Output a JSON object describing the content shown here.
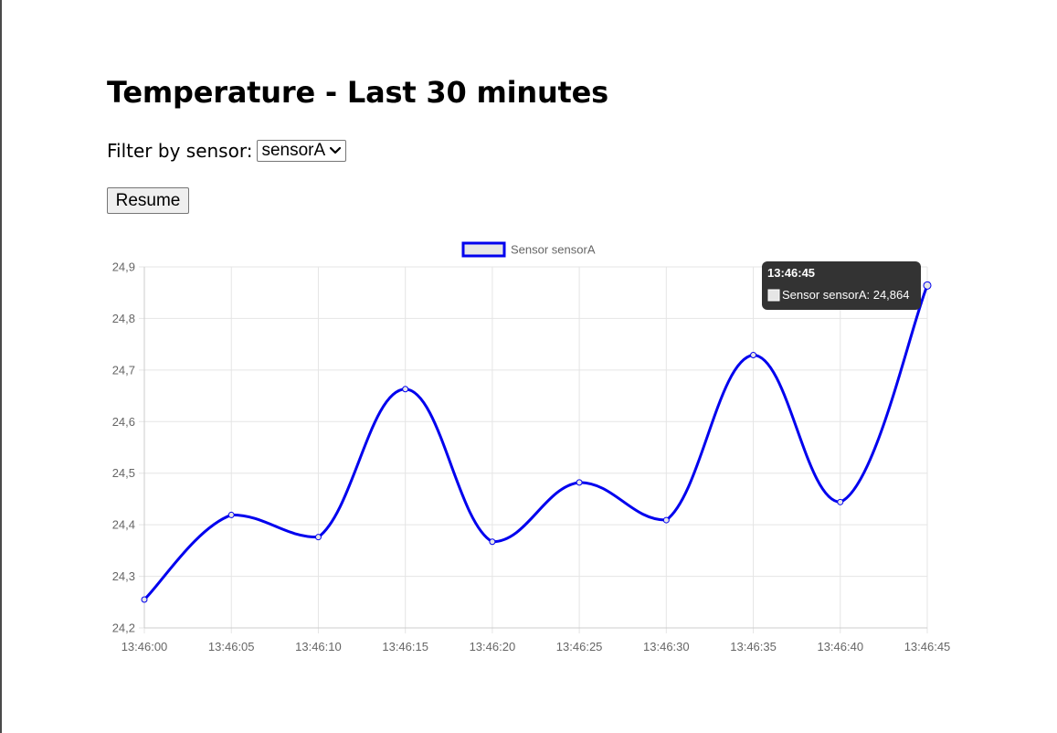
{
  "page": {
    "title": "Temperature - Last 30 minutes"
  },
  "filter": {
    "label": "Filter by sensor:",
    "selected": "sensorA"
  },
  "controls": {
    "resume_label": "Resume"
  },
  "tooltip": {
    "title": "13:46:45",
    "label": "Sensor sensorA: 24,864"
  },
  "colors": {
    "line": "#0000ee",
    "legend_fill": "#e6e6e6",
    "grid": "#e5e5e5",
    "tick_text": "#666666",
    "tooltip_bg": "#333333"
  },
  "chart_data": {
    "type": "line",
    "title": "",
    "xlabel": "",
    "ylabel": "",
    "categories": [
      "13:46:00",
      "13:46:05",
      "13:46:10",
      "13:46:15",
      "13:46:20",
      "13:46:25",
      "13:46:30",
      "13:46:35",
      "13:46:40",
      "13:46:45"
    ],
    "series": [
      {
        "name": "Sensor sensorA",
        "values": [
          24.255,
          24.419,
          24.376,
          24.663,
          24.367,
          24.482,
          24.409,
          24.729,
          24.444,
          24.864
        ]
      }
    ],
    "ylim": [
      24.2,
      24.9
    ],
    "yticks": [
      "24,2",
      "24,3",
      "24,4",
      "24,5",
      "24,6",
      "24,7",
      "24,8",
      "24,9"
    ],
    "grid": true,
    "legend": "top-center",
    "highlighted_point": "13:46:45"
  }
}
